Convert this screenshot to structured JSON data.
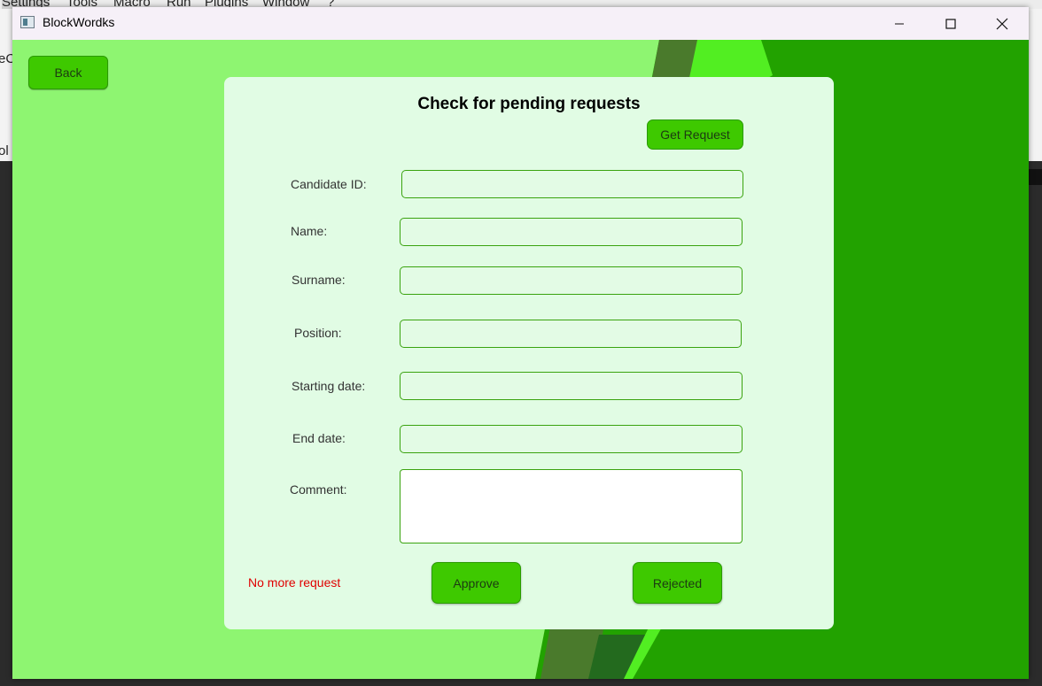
{
  "background_app": {
    "menu": [
      "Settings",
      "Tools",
      "Macro",
      "Run",
      "Plugins",
      "Window",
      "?"
    ],
    "left_fragments": [
      "eC",
      "ol"
    ]
  },
  "window": {
    "title": "BlockWordks"
  },
  "toolbar": {
    "back_label": "Back"
  },
  "panel": {
    "title": "Check for pending requests",
    "get_request_label": "Get Request"
  },
  "form": {
    "candidate_id": {
      "label": "Candidate ID:",
      "value": ""
    },
    "name": {
      "label": "Name:",
      "value": ""
    },
    "surname": {
      "label": "Surname:",
      "value": ""
    },
    "position": {
      "label": "Position:",
      "value": ""
    },
    "starting_date": {
      "label": "Starting date:",
      "value": ""
    },
    "end_date": {
      "label": "End date:",
      "value": ""
    },
    "comment": {
      "label": "Comment:",
      "value": ""
    }
  },
  "status": {
    "message": "No more request"
  },
  "actions": {
    "approve_label": "Approve",
    "reject_label": "Rejected"
  },
  "colors": {
    "accent": "#3ec900",
    "background_light": "#8ef571",
    "background_dark": "#22a200",
    "panel": "#e1fce4",
    "status_error": "#e00000"
  }
}
